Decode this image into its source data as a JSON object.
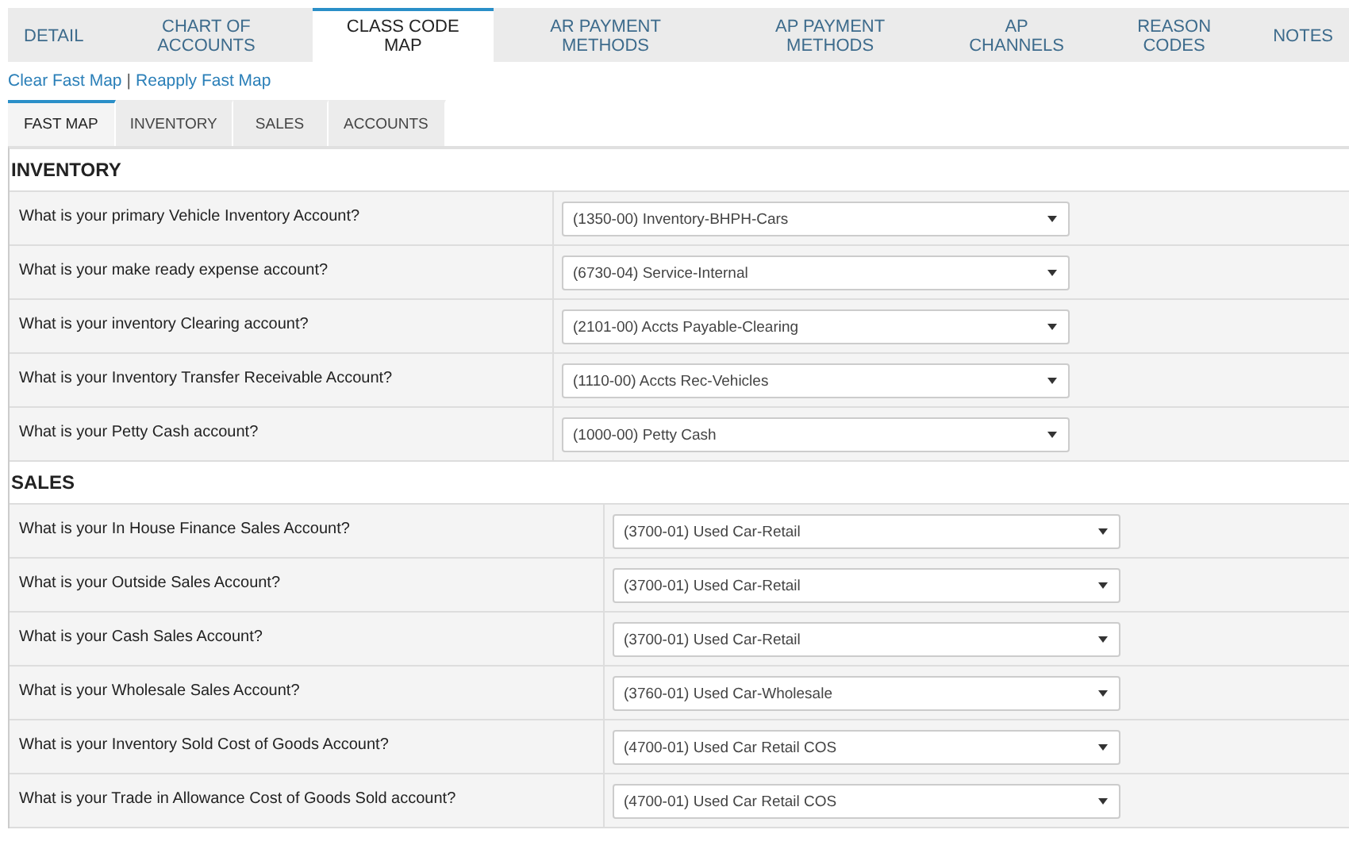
{
  "tabs": [
    {
      "label": "DETAIL",
      "selected": false
    },
    {
      "label": "CHART OF ACCOUNTS",
      "selected": false
    },
    {
      "label": "CLASS CODE MAP",
      "selected": true
    },
    {
      "label": "AR PAYMENT METHODS",
      "selected": false
    },
    {
      "label": "AP PAYMENT METHODS",
      "selected": false
    },
    {
      "label": "AP CHANNELS",
      "selected": false
    },
    {
      "label": "REASON CODES",
      "selected": false
    },
    {
      "label": "NOTES",
      "selected": false
    }
  ],
  "links": [
    "Clear Fast Map",
    "Reapply Fast Map"
  ],
  "link_separator": "|",
  "subtabs": [
    {
      "label": "FAST MAP",
      "selected": true
    },
    {
      "label": "INVENTORY",
      "selected": false
    },
    {
      "label": "SALES",
      "selected": false
    },
    {
      "label": "ACCOUNTS",
      "selected": false
    }
  ],
  "sections": [
    {
      "title": "INVENTORY",
      "rows": [
        {
          "question": "What is your primary Vehicle Inventory Account?",
          "value": "(1350-00) Inventory-BHPH-Cars"
        },
        {
          "question": "What is your make ready expense account?",
          "value": "(6730-04) Service-Internal"
        },
        {
          "question": "What is your inventory Clearing account?",
          "value": "(2101-00) Accts Payable-Clearing"
        },
        {
          "question": "What is your Inventory Transfer Receivable Account?",
          "value": "(1110-00) Accts Rec-Vehicles"
        },
        {
          "question": "What is your Petty Cash account?",
          "value": "(1000-00) Petty Cash"
        }
      ]
    },
    {
      "title": "SALES",
      "rows": [
        {
          "question": "What is your In House Finance Sales Account?",
          "value": "(3700-01) Used Car-Retail"
        },
        {
          "question": "What is your Outside Sales Account?",
          "value": "(3700-01) Used Car-Retail"
        },
        {
          "question": "What is your Cash Sales Account?",
          "value": "(3700-01) Used Car-Retail"
        },
        {
          "question": "What is your Wholesale Sales Account?",
          "value": "(3760-01) Used Car-Wholesale"
        },
        {
          "question": "What is your Inventory Sold Cost of Goods Account?",
          "value": "(4700-01) Used Car Retail COS"
        },
        {
          "question": "What is your Trade in Allowance Cost of Goods Sold account?",
          "value": "(4700-01) Used Car Retail COS"
        }
      ]
    }
  ]
}
